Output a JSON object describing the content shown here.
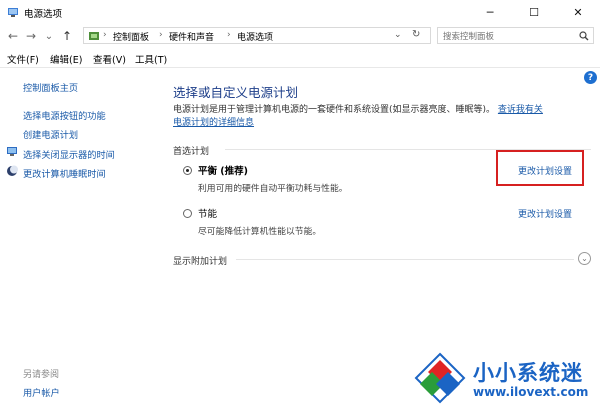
{
  "window": {
    "title": "电源选项",
    "controls": [
      "─",
      "☐",
      "✕"
    ]
  },
  "nav": {
    "back": "←",
    "forward": "→",
    "recent": "⌄",
    "up": "↑",
    "breadcrumb": [
      "控制面板",
      "硬件和声音",
      "电源选项"
    ],
    "sep": "›",
    "dropdown": "⌄",
    "refresh": "↻",
    "search_placeholder": "搜索控制面板"
  },
  "menu": [
    "文件(F)",
    "编辑(E)",
    "查看(V)",
    "工具(T)"
  ],
  "sidebar": {
    "home": "控制面板主页",
    "links": [
      "选择电源按钮的功能",
      "创建电源计划",
      "选择关闭显示器的时间",
      "更改计算机睡眠时间"
    ],
    "see_also": "另请参阅",
    "see_also_links": [
      "用户帐户"
    ]
  },
  "main": {
    "title": "选择或自定义电源计划",
    "desc_line1": "电源计划是用于管理计算机电源的一套硬件和系统设置(如显示器亮度、睡眠等)。",
    "desc_link1": "查诉我有关",
    "desc_link2": "电源计划的详细信息",
    "preferred": "首选计划",
    "plans": [
      {
        "name": "平衡 (推荐)",
        "desc": "利用可用的硬件自动平衡功耗与性能。",
        "link": "更改计划设置",
        "selected": true
      },
      {
        "name": "节能",
        "desc": "尽可能降低计算机性能以节能。",
        "link": "更改计划设置",
        "selected": false
      }
    ],
    "extra": "显示附加计划",
    "help": "?"
  },
  "watermark": {
    "name": "小小系统迷",
    "url": "www.ilovext.com"
  },
  "colors": {
    "link": "#1a5aa8",
    "title": "#1e3f8a",
    "highlight": "#d62020",
    "watermark": "#1b64c4"
  }
}
